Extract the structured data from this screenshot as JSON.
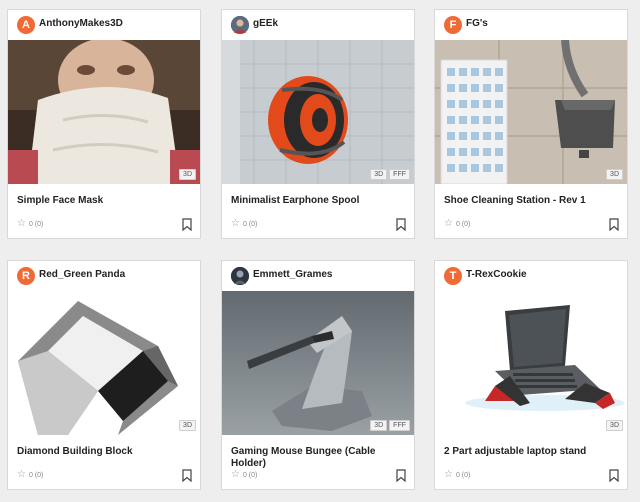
{
  "cards": [
    {
      "user": "AnthonyMakes3D",
      "avatar": "A",
      "avatar_color": "#f06a35",
      "title": "Simple Face Mask",
      "badges": [
        "3D"
      ],
      "rating": "0 (0)"
    },
    {
      "user": "gEEk",
      "avatar": "",
      "avatar_color": "#4a4a4a",
      "title": "Minimalist Earphone Spool",
      "badges": [
        "3D",
        "FFF"
      ],
      "rating": "0 (0)"
    },
    {
      "user": "FG's",
      "avatar": "F",
      "avatar_color": "#f06a35",
      "title": "Shoe Cleaning Station - Rev 1",
      "badges": [
        "3D"
      ],
      "rating": "0 (0)"
    },
    {
      "user": "Red_Green Panda",
      "avatar": "R",
      "avatar_color": "#f06a35",
      "title": "Diamond Building Block",
      "badges": [
        "3D"
      ],
      "rating": "0 (0)"
    },
    {
      "user": "Emmett_Grames",
      "avatar": "",
      "avatar_color": "#3a3a3a",
      "title": "Gaming Mouse Bungee (Cable Holder)",
      "badges": [
        "3D",
        "FFF"
      ],
      "rating": "0 (0)"
    },
    {
      "user": "T-RexCookie",
      "avatar": "T",
      "avatar_color": "#f06a35",
      "title": "2 Part adjustable laptop stand",
      "badges": [
        "3D"
      ],
      "rating": "0 (0)"
    }
  ],
  "icons": {
    "star": "star-icon",
    "bookmark": "bookmark-icon"
  }
}
